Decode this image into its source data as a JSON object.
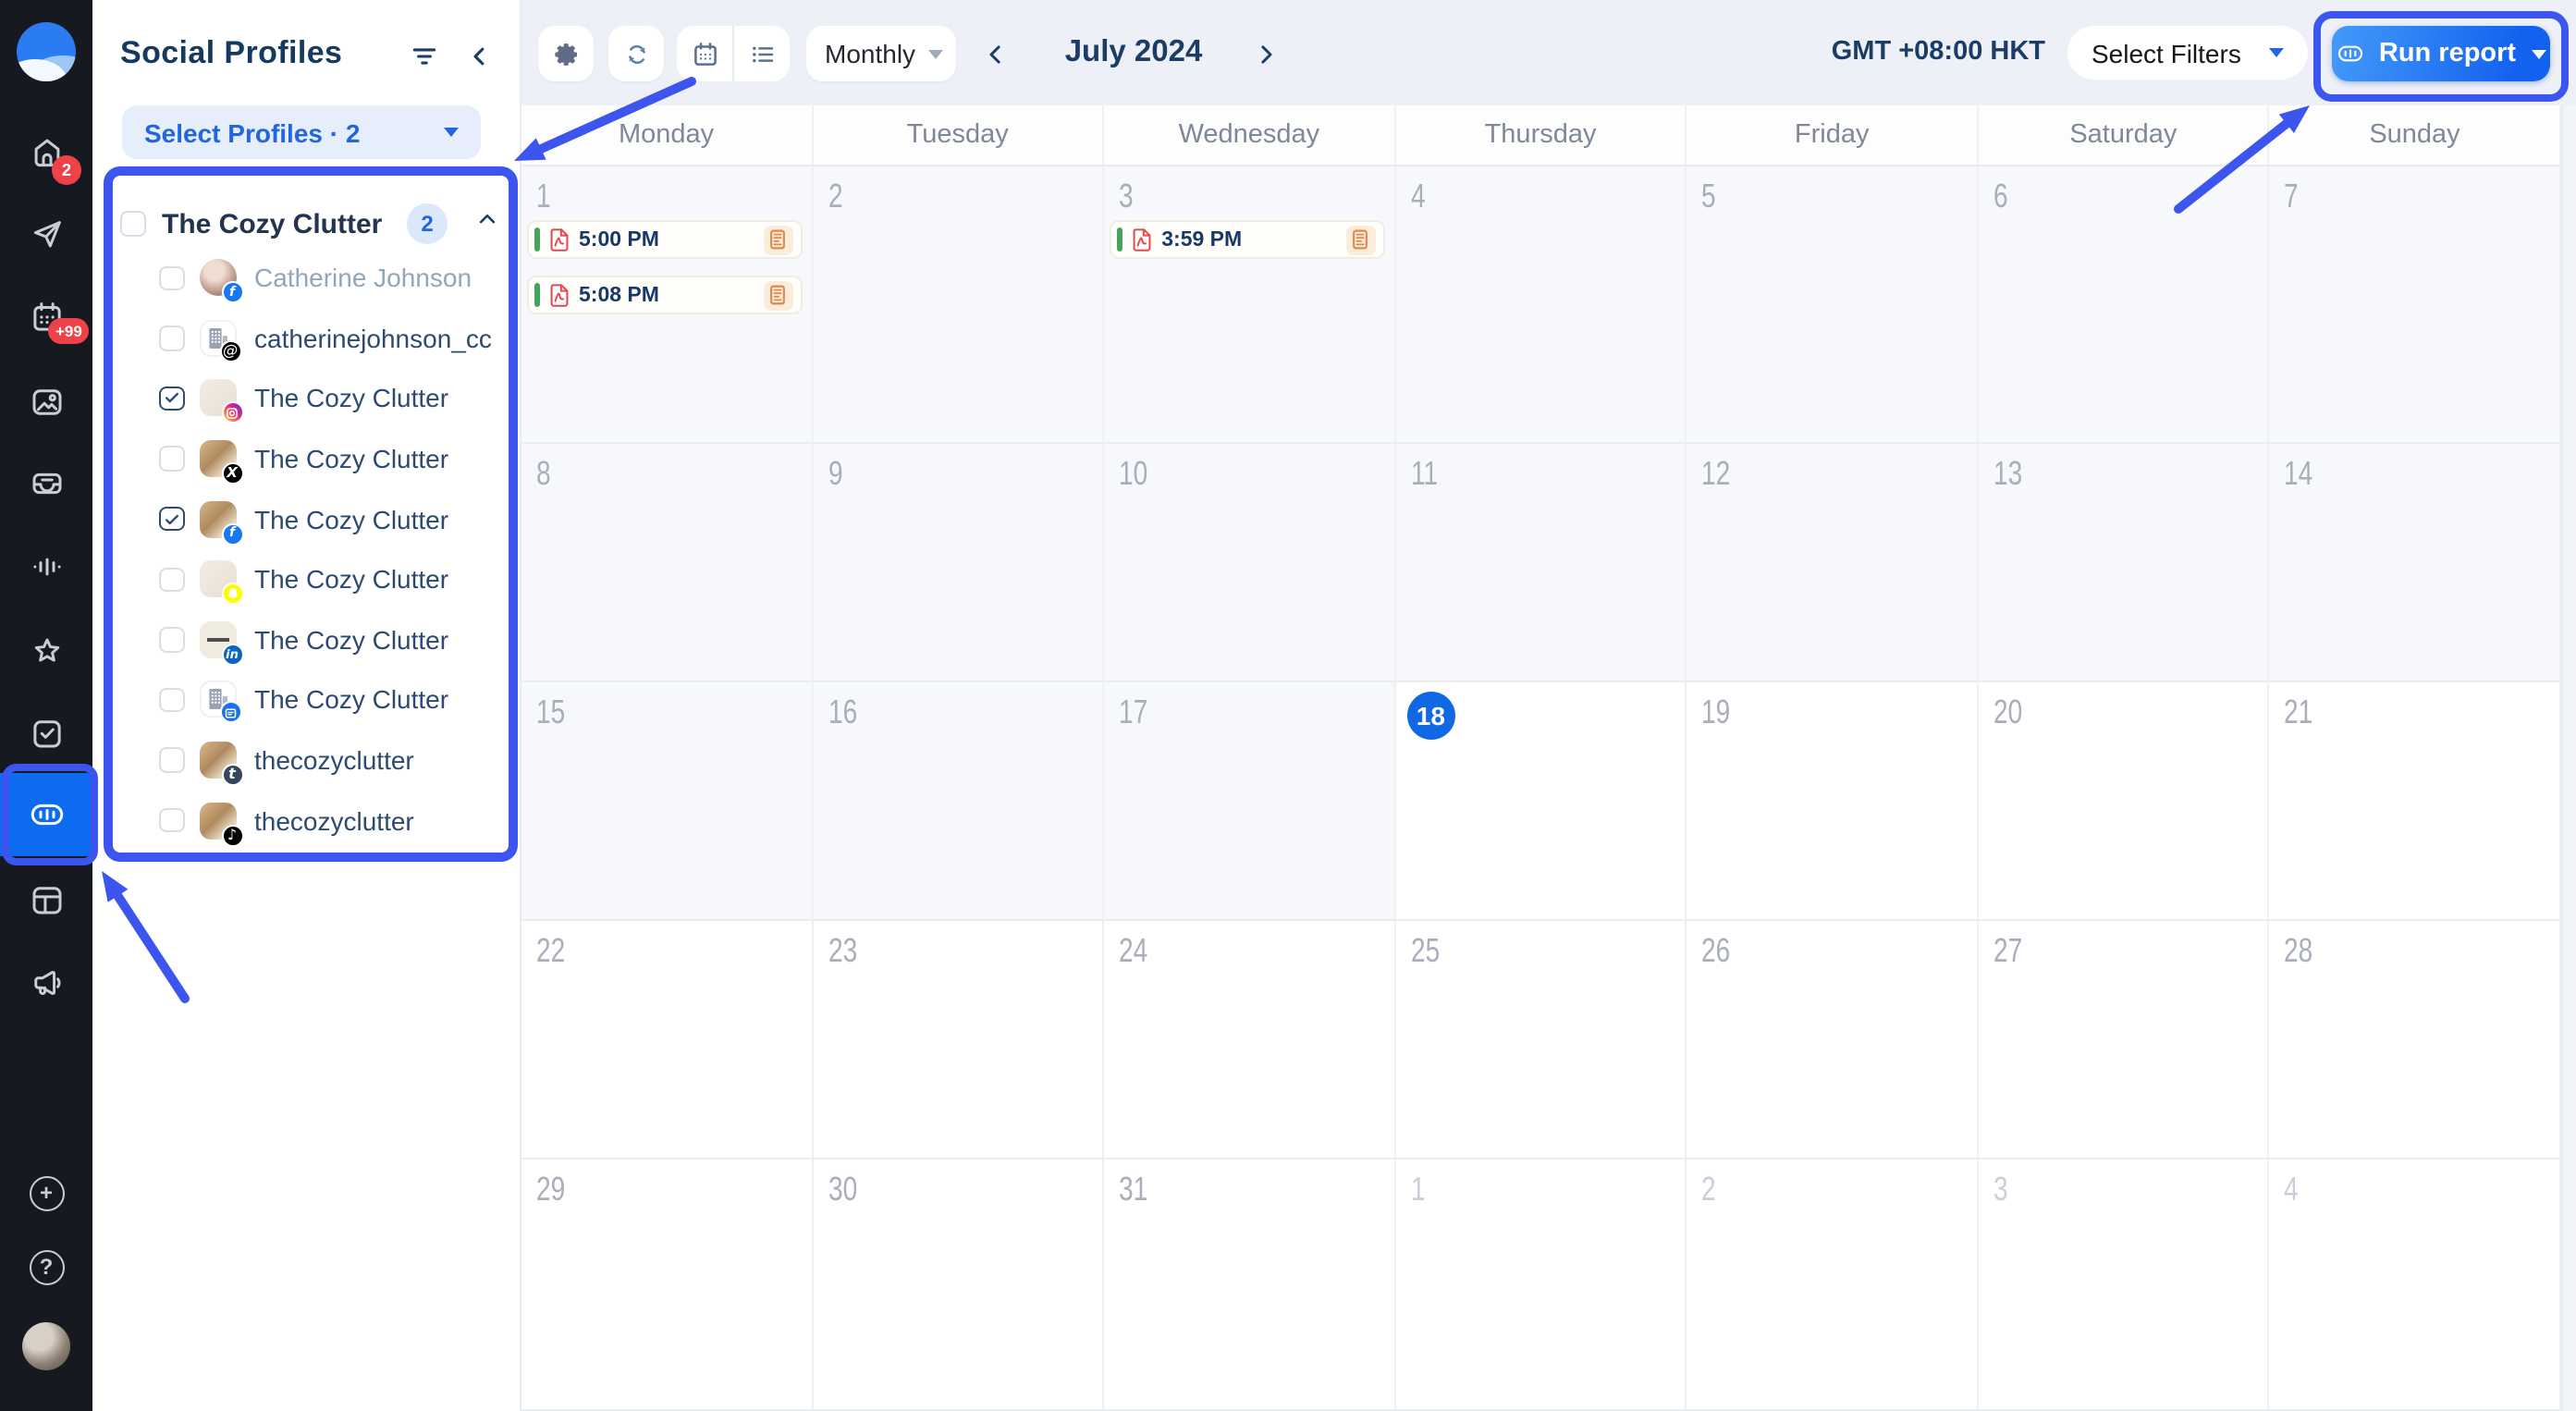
{
  "colors": {
    "annotation": "#3c55ef",
    "accent_blue": "#2166e0",
    "today_blue": "#1168e3",
    "event_green": "#43a45f",
    "badge_red": "#ee4148",
    "run_gradient_start": "#449af9",
    "run_gradient_end": "#1261ef",
    "sidebar_bg": "#171920"
  },
  "sidebar": {
    "badges": {
      "home": "2",
      "calendar": "+99"
    },
    "items": [
      "home",
      "publishing",
      "calendar",
      "media",
      "inbox",
      "listening",
      "reviews",
      "tasks",
      "analytics",
      "feeds",
      "advocacy"
    ],
    "active_item": "analytics",
    "bottom_items": [
      "add",
      "help",
      "account-avatar"
    ]
  },
  "profiles_panel": {
    "title": "Social Profiles",
    "select_label": "Select Profiles · 2",
    "group": {
      "name": "The Cozy Clutter",
      "count": "2"
    },
    "items": [
      {
        "name": "Catherine Johnson",
        "platform": "facebook",
        "avatar": "photo",
        "selected": false,
        "muted": true
      },
      {
        "name": "catherinejohnson_cc",
        "platform": "threads",
        "avatar": "building",
        "selected": false,
        "muted": false
      },
      {
        "name": "The Cozy Clutter",
        "platform": "instagram",
        "avatar": "beige",
        "selected": true,
        "muted": false
      },
      {
        "name": "The Cozy Clutter",
        "platform": "x",
        "avatar": "clutter",
        "selected": false,
        "muted": false
      },
      {
        "name": "The Cozy Clutter",
        "platform": "facebook",
        "avatar": "clutter",
        "selected": true,
        "muted": false
      },
      {
        "name": "The Cozy Clutter",
        "platform": "snapchat",
        "avatar": "beige",
        "selected": false,
        "muted": false
      },
      {
        "name": "The Cozy Clutter",
        "platform": "linkedin",
        "avatar": "cream",
        "selected": false,
        "muted": false
      },
      {
        "name": "The Cozy Clutter",
        "platform": "google-business",
        "avatar": "building",
        "selected": false,
        "muted": false
      },
      {
        "name": "thecozyclutter",
        "platform": "tumblr",
        "avatar": "clutter",
        "selected": false,
        "muted": false
      },
      {
        "name": "thecozyclutter",
        "platform": "tiktok",
        "avatar": "clutter",
        "selected": false,
        "muted": false
      }
    ]
  },
  "toolbar": {
    "view": "Monthly",
    "month": "July 2024",
    "timezone": "GMT +08:00 HKT",
    "filters_label": "Select Filters",
    "run_label": "Run report"
  },
  "calendar": {
    "weekdays": [
      "Monday",
      "Tuesday",
      "Wednesday",
      "Thursday",
      "Friday",
      "Saturday",
      "Sunday"
    ],
    "cells": [
      {
        "day": "1",
        "state": "past",
        "events": [
          {
            "time": "5:00 PM"
          },
          {
            "time": "5:08 PM"
          }
        ]
      },
      {
        "day": "2",
        "state": "past"
      },
      {
        "day": "3",
        "state": "past",
        "events": [
          {
            "time": "3:59 PM"
          }
        ]
      },
      {
        "day": "4",
        "state": "past"
      },
      {
        "day": "5",
        "state": "past"
      },
      {
        "day": "6",
        "state": "past"
      },
      {
        "day": "7",
        "state": "past"
      },
      {
        "day": "8",
        "state": "past"
      },
      {
        "day": "9",
        "state": "past"
      },
      {
        "day": "10",
        "state": "past"
      },
      {
        "day": "11",
        "state": "past"
      },
      {
        "day": "12",
        "state": "past"
      },
      {
        "day": "13",
        "state": "past"
      },
      {
        "day": "14",
        "state": "past"
      },
      {
        "day": "15",
        "state": "past"
      },
      {
        "day": "16",
        "state": "past"
      },
      {
        "day": "17",
        "state": "past"
      },
      {
        "day": "18",
        "state": "today"
      },
      {
        "day": "19",
        "state": "future"
      },
      {
        "day": "20",
        "state": "future"
      },
      {
        "day": "21",
        "state": "future"
      },
      {
        "day": "22",
        "state": "future"
      },
      {
        "day": "23",
        "state": "future"
      },
      {
        "day": "24",
        "state": "future"
      },
      {
        "day": "25",
        "state": "future"
      },
      {
        "day": "26",
        "state": "future"
      },
      {
        "day": "27",
        "state": "future"
      },
      {
        "day": "28",
        "state": "future"
      },
      {
        "day": "29",
        "state": "future"
      },
      {
        "day": "30",
        "state": "future"
      },
      {
        "day": "31",
        "state": "future"
      },
      {
        "day": "1",
        "state": "adjacent"
      },
      {
        "day": "2",
        "state": "adjacent"
      },
      {
        "day": "3",
        "state": "adjacent"
      },
      {
        "day": "4",
        "state": "adjacent"
      }
    ]
  },
  "annotations": {
    "highlighted": [
      "social-profiles-list",
      "run-report-button",
      "analytics-nav-item"
    ]
  }
}
